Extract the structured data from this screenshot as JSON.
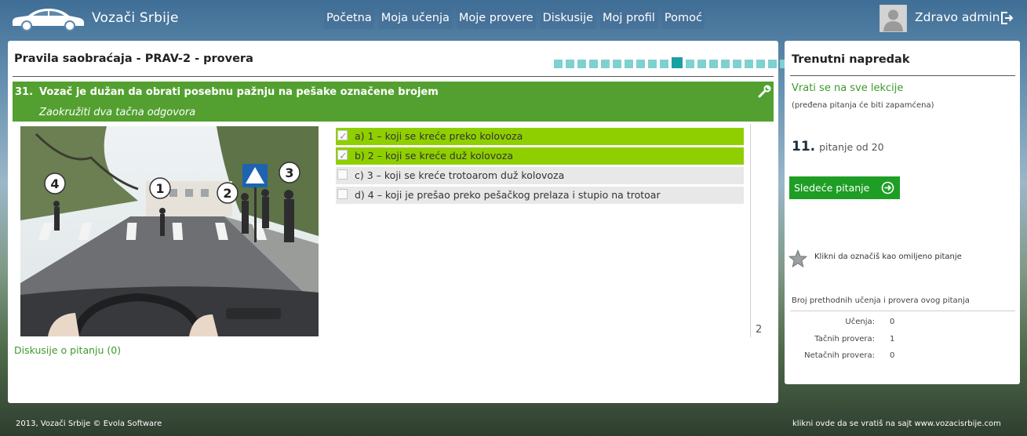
{
  "header": {
    "brand": "Vozači Srbije",
    "nav": [
      "Početna",
      "Moja učenja",
      "Moje provere",
      "Diskusije",
      "Moj profil",
      "Pomoć"
    ],
    "greeting": "Zdravo admin"
  },
  "main": {
    "title": "Pravila saobraćaja - PRAV-2 - provera",
    "progress": {
      "total": 20,
      "current": 11
    },
    "question": {
      "number": "31.",
      "text": "Vozač je dužan da obrati posebnu pažnju na pešake označene brojem",
      "instruction": "Zaokružiti dva tačna odgovora",
      "image_labels": [
        "4",
        "1",
        "2",
        "3"
      ]
    },
    "answers": [
      {
        "text": "a) 1 – koji se kreće preko kolovoza",
        "selected": true
      },
      {
        "text": "b) 2 – koji se kreće duž kolovoza",
        "selected": true
      },
      {
        "text": "c) 3 – koji se kreće trotoarom duž kolovoza",
        "selected": false
      },
      {
        "text": "d) 4 – koji je prešao preko pešačkog prelaza i stupio na trotoar",
        "selected": false
      }
    ],
    "side_number": "2",
    "discussion_link": "Diskusije o pitanju (0)"
  },
  "sidebar": {
    "title": "Trenutni napredak",
    "back_link": "Vrati se na sve lekcije",
    "back_note": "(pređena pitanja će biti zapamćena)",
    "question_number": "11.",
    "question_of": "pitanje od 20",
    "next_button": "Sledeće pitanje",
    "favorite_text": "Klikni da označiš kao omiljeno pitanje",
    "history_title": "Broj prethodnih učenja i provera ovog pitanja",
    "history": [
      {
        "label": "Učenja:",
        "value": "0"
      },
      {
        "label": "Tačnih provera:",
        "value": "1"
      },
      {
        "label": "Netačnih provera:",
        "value": "0"
      }
    ]
  },
  "footer": {
    "copyright": "2013, Vozači Srbije © Evola Software",
    "site_link": "klikni ovde da se vratiš na sajt  www.vozacisrbije.com"
  },
  "colors": {
    "accent_green": "#53a030",
    "selected_answer": "#8fcf00",
    "next_button": "#1e9e24",
    "progress_square": "#7fd0d0",
    "progress_current": "#19a1a1"
  }
}
